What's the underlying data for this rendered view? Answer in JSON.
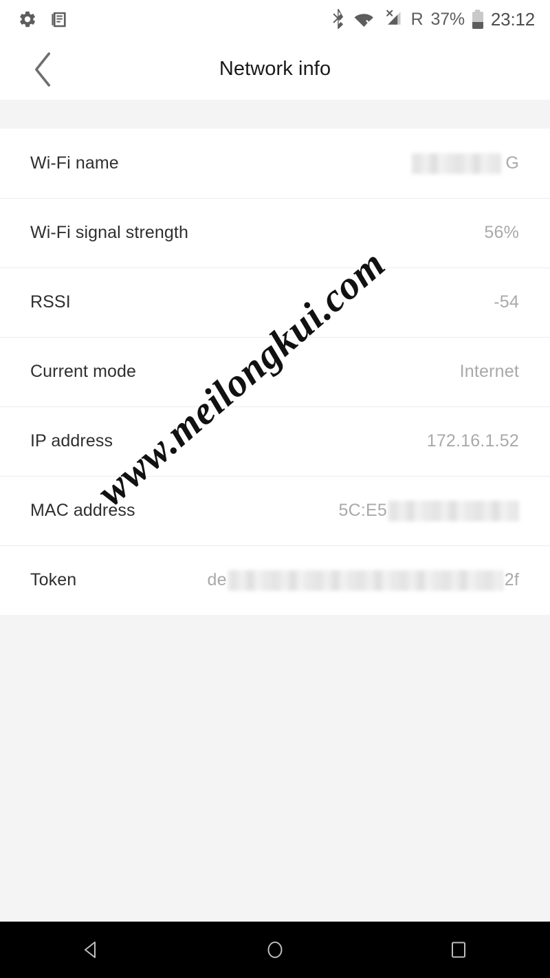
{
  "status_bar": {
    "left_icons": [
      {
        "name": "settings-gear-icon",
        "glyph": "gear"
      },
      {
        "name": "news-document-icon",
        "glyph": "document"
      }
    ],
    "right_icons": [
      {
        "name": "bluetooth-icon",
        "glyph": "bluetooth"
      },
      {
        "name": "wifi-disconnected-icon",
        "glyph": "wifi-x"
      },
      {
        "name": "cellular-signal-off-icon",
        "glyph": "signal-x"
      }
    ],
    "roaming_label": "R",
    "battery_percent_label": "37%",
    "battery_level": 37,
    "time": "23:12",
    "icon_color": "#5d5d5d",
    "background": "#ffffff"
  },
  "titlebar": {
    "back_icon": "chevron-left-icon",
    "title": "Network info",
    "background": "#ffffff",
    "title_color": "#1a1a1a"
  },
  "list": {
    "rows": [
      {
        "label": "Wi-Fi name",
        "value_prefix": "",
        "redacted": true,
        "redact_class": "w-wifi",
        "value_suffix": "G"
      },
      {
        "label": "Wi-Fi signal strength",
        "value_prefix": "56%",
        "redacted": false,
        "redact_class": "",
        "value_suffix": ""
      },
      {
        "label": "RSSI",
        "value_prefix": "-54",
        "redacted": false,
        "redact_class": "",
        "value_suffix": ""
      },
      {
        "label": "Current mode",
        "value_prefix": "Internet",
        "redacted": false,
        "redact_class": "",
        "value_suffix": ""
      },
      {
        "label": "IP address",
        "value_prefix": "172.16.1.52",
        "redacted": false,
        "redact_class": "",
        "value_suffix": ""
      },
      {
        "label": "MAC address",
        "value_prefix": "5C:E5",
        "redacted": true,
        "redact_class": "w-mac",
        "value_suffix": ""
      },
      {
        "label": "Token",
        "value_prefix": "de",
        "redacted": true,
        "redact_class": "w-token",
        "value_suffix": "2f"
      }
    ],
    "label_color": "#2f2f2f",
    "value_color": "#a9a9a9",
    "divider_color": "#ececec",
    "card_background": "#ffffff"
  },
  "page": {
    "background": "#f4f4f4"
  },
  "watermark": {
    "text": "www.meilongkui.com",
    "rotation_deg": -41,
    "color": "#111111"
  },
  "nav_bar": {
    "background": "#000000",
    "icon_color": "#bdbdbd",
    "buttons": [
      {
        "name": "nav-back-button",
        "glyph": "triangle-left"
      },
      {
        "name": "nav-home-button",
        "glyph": "circle"
      },
      {
        "name": "nav-recents-button",
        "glyph": "square"
      }
    ]
  }
}
